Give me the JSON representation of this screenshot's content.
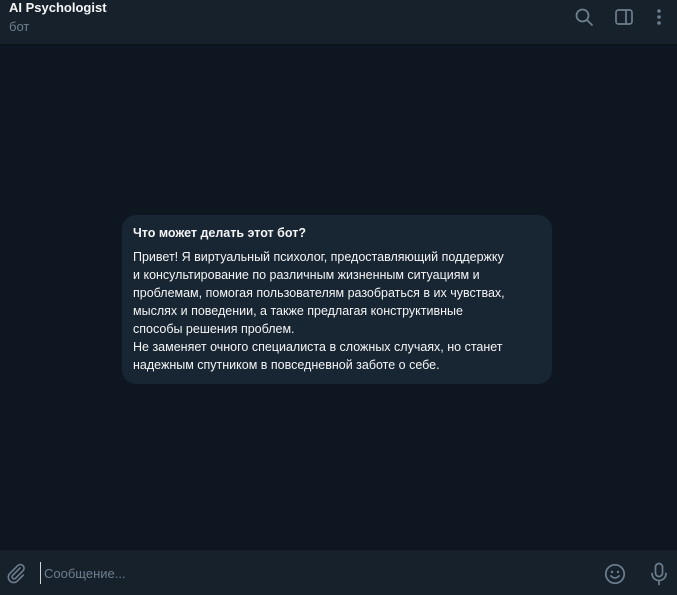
{
  "header": {
    "title": "AI Psychologist",
    "subtitle": "бот"
  },
  "icons": {
    "search": "search-icon",
    "sidebar": "sidebar-toggle-icon",
    "more": "more-vertical-icon",
    "attach": "paperclip-icon",
    "emoji": "emoji-icon",
    "mic": "microphone-icon"
  },
  "bot_info": {
    "title": "Что может делать этот бот?",
    "lines": [
      "Привет! Я виртуальный психолог, предоставляющий поддержку",
      "и консультирование по различным жизненным ситуациям и",
      "проблемам, помогая пользователям разобраться в их чувствах,",
      "мыслях и поведении, а также предлагая конструктивные",
      "способы решения проблем.",
      "Не заменяет очного специалиста в сложных случаях, но станет",
      "надежным спутником в повседневной заботе о себе."
    ]
  },
  "composer": {
    "placeholder": "Сообщение...",
    "value": ""
  },
  "colors": {
    "background": "#0e1621",
    "panel": "#17212b",
    "bubble": "#182533",
    "muted_text": "#6d7f8f",
    "icon": "#6d7f8f"
  }
}
